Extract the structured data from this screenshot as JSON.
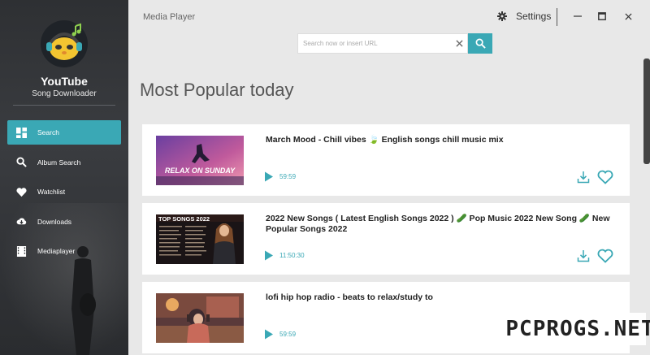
{
  "sidebar": {
    "app_name": "YouTube",
    "app_subtitle": "Song Downloader",
    "items": [
      {
        "label": "Search",
        "icon": "dashboard-icon"
      },
      {
        "label": "Album Search",
        "icon": "search-icon"
      },
      {
        "label": "Watchlist",
        "icon": "heart-icon"
      },
      {
        "label": "Downloads",
        "icon": "cloud-download-icon"
      },
      {
        "label": "Mediaplayer",
        "icon": "film-icon"
      }
    ]
  },
  "window": {
    "title": "Media Player",
    "settings_label": "Settings"
  },
  "search": {
    "placeholder": "Search now or insert URL",
    "value": ""
  },
  "main": {
    "heading": "Most Popular today",
    "videos": [
      {
        "title": "March Mood - Chill vibes 🍃 English songs chill music mix",
        "duration": "59:59",
        "thumb_text": "RELAX ON SUNDAY"
      },
      {
        "title": "2022 New Songs ( Latest English Songs 2022 ) 🥒 Pop Music 2022 New Song 🥒 New Popular Songs 2022",
        "duration": "11:50:30",
        "thumb_text": "TOP SONGS 2022"
      },
      {
        "title": "lofi hip hop radio - beats to relax/study to",
        "duration": "59:59",
        "thumb_text": ""
      }
    ]
  },
  "watermark": "PCPROGS.NET",
  "colors": {
    "accent": "#3aa8b5",
    "sidebar": "#2e3033",
    "background": "#e8e8e8"
  }
}
